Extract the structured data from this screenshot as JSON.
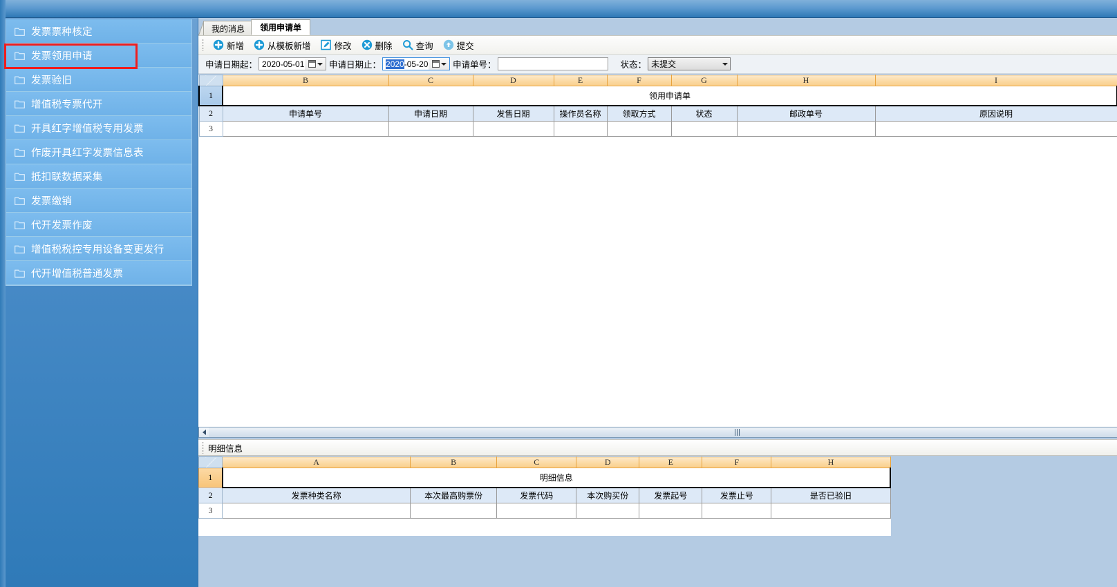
{
  "sidebar": {
    "items": [
      {
        "label": "发票票种核定",
        "icon": "folder-icon"
      },
      {
        "label": "发票领用申请",
        "icon": "folder-icon",
        "highlighted": true
      },
      {
        "label": "发票验旧",
        "icon": "folder-icon"
      },
      {
        "label": "增值税专票代开",
        "icon": "folder-icon"
      },
      {
        "label": "开具红字增值税专用发票",
        "icon": "folder-icon"
      },
      {
        "label": "作废开具红字发票信息表",
        "icon": "folder-open-icon"
      },
      {
        "label": "抵扣联数据采集",
        "icon": "folder-icon"
      },
      {
        "label": "发票缴销",
        "icon": "folder-icon"
      },
      {
        "label": "代开发票作废",
        "icon": "folder-icon"
      },
      {
        "label": "增值税税控专用设备变更发行",
        "icon": "folder-icon"
      },
      {
        "label": "代开增值税普通发票",
        "icon": "folder-icon"
      }
    ],
    "highlight_color": "#f01d1d"
  },
  "tabs": [
    {
      "label": "我的消息",
      "active": false
    },
    {
      "label": "领用申请单",
      "active": true
    }
  ],
  "toolbar": {
    "buttons": [
      {
        "label": "新增",
        "icon": "plus-circle-icon"
      },
      {
        "label": "从模板新增",
        "icon": "plus-circle-icon"
      },
      {
        "label": "修改",
        "icon": "edit-pencil-icon"
      },
      {
        "label": "删除",
        "icon": "close-circle-icon"
      },
      {
        "label": "查询",
        "icon": "search-icon"
      },
      {
        "label": "提交",
        "icon": "upload-circle-icon"
      }
    ]
  },
  "filters": {
    "date_from_label": "申请日期起：",
    "date_from_value": "2020-05-01",
    "date_to_label": "申请日期止：",
    "date_to_value_selected": "2020",
    "date_to_value_rest": "-05-20",
    "apply_no_label": "申请单号：",
    "apply_no_value": "",
    "apply_no_placeholder": "",
    "status_label": "状态：",
    "status_value": "未提交"
  },
  "main_grid": {
    "column_letters": [
      "B",
      "C",
      "D",
      "E",
      "F",
      "G",
      "H",
      "I"
    ],
    "row_numbers": [
      "1",
      "2",
      "3"
    ],
    "title": "领用申请单",
    "headers": [
      "申请单号",
      "申请日期",
      "发售日期",
      "操作员名称",
      "领取方式",
      "状态",
      "邮政单号",
      "原因说明"
    ],
    "rows": [
      [
        "",
        "",
        "",
        "",
        "",
        "",
        "",
        ""
      ]
    ]
  },
  "detail_panel": {
    "bar_label": "明细信息",
    "column_letters": [
      "A",
      "B",
      "C",
      "D",
      "E",
      "F",
      "H"
    ],
    "row_numbers": [
      "1",
      "2",
      "3"
    ],
    "title": "明细信息",
    "headers": [
      "发票种类名称",
      "本次最高购票份",
      "发票代码",
      "本次购买份",
      "发票起号",
      "发票止号",
      "是否已验旧"
    ],
    "rows": [
      [
        "",
        "",
        "",
        "",
        "",
        "",
        ""
      ]
    ]
  },
  "scrollbar": {
    "left_arrow": "scroll-left-arrow-icon"
  }
}
